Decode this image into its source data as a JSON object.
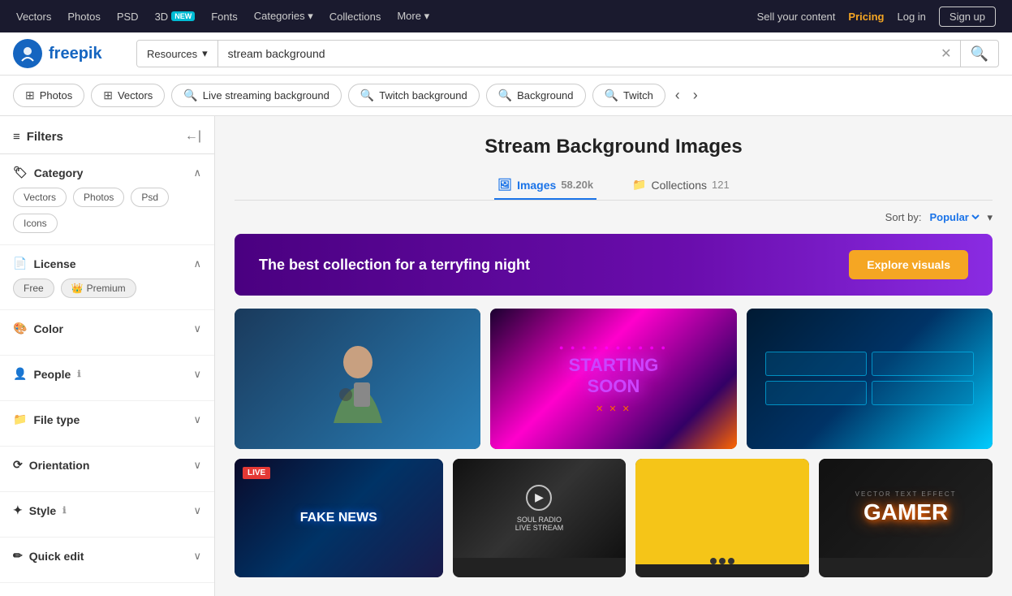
{
  "topNav": {
    "links": [
      {
        "label": "Vectors",
        "id": "vectors"
      },
      {
        "label": "Photos",
        "id": "photos"
      },
      {
        "label": "PSD",
        "id": "psd"
      },
      {
        "label": "3D",
        "id": "3d",
        "badge": "NEW"
      },
      {
        "label": "Fonts",
        "id": "fonts"
      },
      {
        "label": "Categories",
        "id": "categories",
        "hasArrow": true
      },
      {
        "label": "Collections",
        "id": "collections"
      },
      {
        "label": "More",
        "id": "more",
        "hasArrow": true
      }
    ],
    "right": [
      {
        "label": "Sell your content",
        "id": "sell"
      },
      {
        "label": "Pricing",
        "id": "pricing",
        "highlight": true
      },
      {
        "label": "Log in",
        "id": "login"
      },
      {
        "label": "Sign up",
        "id": "signup",
        "isButton": true
      }
    ]
  },
  "search": {
    "resourceLabel": "Resources",
    "query": "stream background",
    "placeholder": "stream background"
  },
  "filterChips": [
    {
      "label": "Photos",
      "icon": "photo"
    },
    {
      "label": "Vectors",
      "icon": "vector"
    },
    {
      "label": "Live streaming background",
      "icon": "search"
    },
    {
      "label": "Twitch background",
      "icon": "search"
    },
    {
      "label": "Background",
      "icon": "search"
    },
    {
      "label": "Twitch",
      "icon": "search"
    }
  ],
  "sidebar": {
    "title": "Filters",
    "sections": [
      {
        "id": "category",
        "title": "Category",
        "icon": "tag",
        "expanded": true,
        "options": [
          {
            "label": "Vectors"
          },
          {
            "label": "Photos"
          },
          {
            "label": "Psd"
          },
          {
            "label": "Icons"
          }
        ]
      },
      {
        "id": "license",
        "title": "License",
        "icon": "license",
        "expanded": true,
        "options": [
          {
            "label": "Free"
          },
          {
            "label": "Premium",
            "hasCrown": true
          }
        ]
      },
      {
        "id": "color",
        "title": "Color",
        "icon": "palette",
        "expanded": false
      },
      {
        "id": "people",
        "title": "People",
        "icon": "person",
        "hasInfo": true,
        "expanded": false
      },
      {
        "id": "filetype",
        "title": "File type",
        "icon": "file",
        "expanded": false
      },
      {
        "id": "orientation",
        "title": "Orientation",
        "icon": "orientation",
        "expanded": false
      },
      {
        "id": "style",
        "title": "Style",
        "icon": "style",
        "hasInfo": true,
        "expanded": false
      },
      {
        "id": "quickedit",
        "title": "Quick edit",
        "icon": "edit",
        "expanded": false
      }
    ]
  },
  "content": {
    "pageTitle": "Stream Background Images",
    "tabs": [
      {
        "label": "Images",
        "count": "58.20k",
        "active": true,
        "icon": "image"
      },
      {
        "label": "Collections",
        "count": "121",
        "active": false,
        "icon": "folder"
      }
    ],
    "sortBy": "Sort by:",
    "sortValue": "Popular",
    "promoBanner": {
      "text": "The best collection for a terryfing night",
      "buttonLabel": "Explore visuals"
    }
  }
}
